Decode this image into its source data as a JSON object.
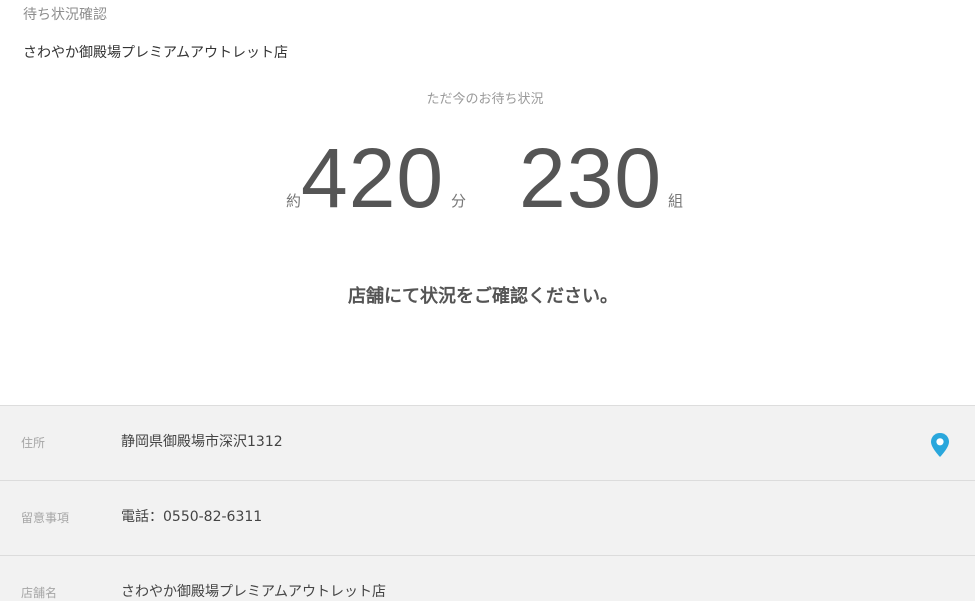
{
  "header": {
    "title": "待ち状況確認",
    "store_name": "さわやか御殿場プレミアムアウトレット店"
  },
  "wait_status": {
    "label": "ただ今のお待ち状況",
    "time_prefix": "約",
    "time_value": "420",
    "time_unit": "分",
    "groups_value": "230",
    "groups_unit": "組",
    "message": "店舗にて状況をご確認ください。"
  },
  "info": {
    "rows": [
      {
        "label": "住所",
        "value": "静岡県御殿場市深沢1312",
        "icon": "map-pin-icon"
      },
      {
        "label": "留意事項",
        "value": "電話：0550-82-6311"
      },
      {
        "label": "店舗名",
        "value": "さわやか御殿場プレミアムアウトレット店"
      }
    ]
  },
  "colors": {
    "accent": "#2aa7dc",
    "info_background": "#f2f2f2",
    "number": "#555555"
  }
}
